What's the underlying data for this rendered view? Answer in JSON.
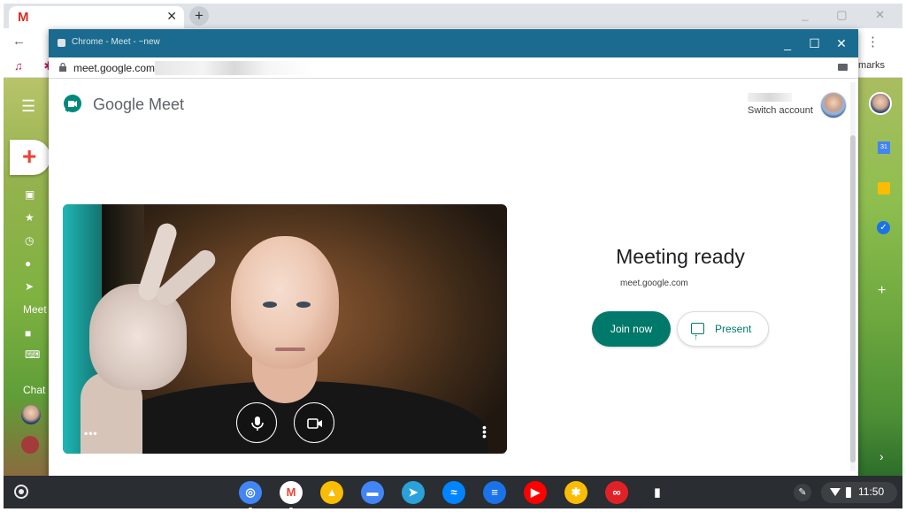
{
  "background_window": {
    "tab_title_letter": "M",
    "bookmarks_fragment": "kmarks",
    "meet_sidebar_label": "Meet",
    "chat_sidebar_label": "Chat",
    "calendar_badge": "31"
  },
  "popup": {
    "title": "Chrome - Meet - ~new",
    "url": "meet.google.com"
  },
  "meet": {
    "brand": "Google Meet",
    "switch_account": "Switch account",
    "meeting_ready": "Meeting ready",
    "meeting_url": "meet.google.com",
    "join_now": "Join now",
    "present": "Present"
  },
  "shelf": {
    "time": "11:50",
    "apps": [
      {
        "name": "chrome",
        "color": "#4285f4"
      },
      {
        "name": "gmail",
        "color": "#ea4335"
      },
      {
        "name": "google-drive",
        "color": "#fbbc04"
      },
      {
        "name": "files",
        "color": "#4285f4"
      },
      {
        "name": "telegram",
        "color": "#2aa1da"
      },
      {
        "name": "messenger",
        "color": "#0084ff"
      },
      {
        "name": "messages",
        "color": "#1a73e8"
      },
      {
        "name": "youtube",
        "color": "#ff0000"
      },
      {
        "name": "google-photos",
        "color": "#fbbc04"
      },
      {
        "name": "adobe-acrobat",
        "color": "#e02226"
      },
      {
        "name": "bitwarden",
        "color": "#ffffff"
      }
    ]
  },
  "colors": {
    "meet_titlebar": "#1a6b8f",
    "join_button": "#00796b",
    "shelf": "#2a2d31"
  }
}
